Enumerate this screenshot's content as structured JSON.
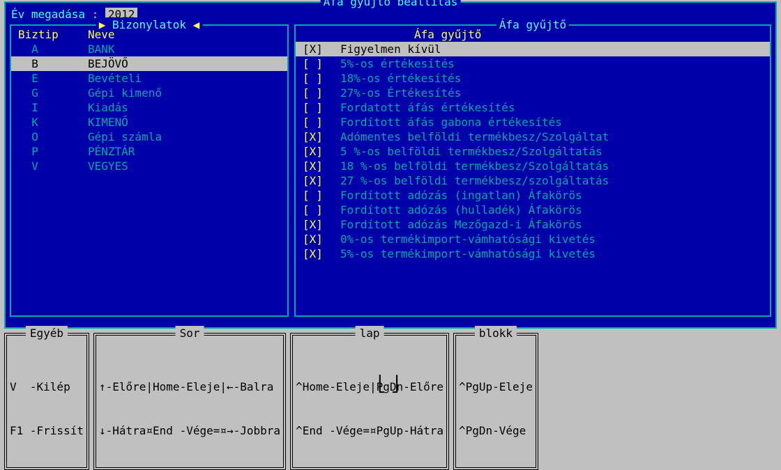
{
  "window_title": "Áfa gyűjtő beállítás",
  "year_label": "Év megadása : ",
  "year_value": "2012",
  "left_panel": {
    "title": "Bizonylatok",
    "col1": "Biztip",
    "col2": "Neve",
    "rows": [
      {
        "code": "A",
        "name": "BANK",
        "selected": false
      },
      {
        "code": "B",
        "name": "BEJÖVŐ",
        "selected": true
      },
      {
        "code": "E",
        "name": "Bevételi",
        "selected": false
      },
      {
        "code": "G",
        "name": "Gépi kimenő",
        "selected": false
      },
      {
        "code": "I",
        "name": "Kiadás",
        "selected": false
      },
      {
        "code": "K",
        "name": "KIMENŐ",
        "selected": false
      },
      {
        "code": "O",
        "name": "Gépi számla",
        "selected": false
      },
      {
        "code": "P",
        "name": "PÉNZTÁR",
        "selected": false
      },
      {
        "code": "V",
        "name": "VEGYES",
        "selected": false
      }
    ]
  },
  "right_panel": {
    "title": "Áfa gyűjtő",
    "header": "Áfa gyűjtő",
    "rows": [
      {
        "checked": true,
        "name": "Figyelmen kívül",
        "selected": true
      },
      {
        "checked": false,
        "name": "5%-os értékesítés",
        "selected": false
      },
      {
        "checked": false,
        "name": "18%-os értékesítés",
        "selected": false
      },
      {
        "checked": false,
        "name": "27%-os Értékesítés",
        "selected": false
      },
      {
        "checked": false,
        "name": "Fordatott áfás értékesítés",
        "selected": false
      },
      {
        "checked": false,
        "name": "Fordított áfás gabona értékesítés",
        "selected": false
      },
      {
        "checked": true,
        "name": "Adómentes belföldi termékbesz/Szolgáltat",
        "selected": false
      },
      {
        "checked": true,
        "name": "5 %-os  belföldi termékbesz/Szolgáltatás",
        "selected": false
      },
      {
        "checked": true,
        "name": "18 %-os belföldi termékbesz/Szolgáltatás",
        "selected": false
      },
      {
        "checked": true,
        "name": "27 %-os belföldi termékbesz/szolgáltatás",
        "selected": false
      },
      {
        "checked": false,
        "name": "Fordított adózás (ingatlan) Áfakörös",
        "selected": false
      },
      {
        "checked": false,
        "name": "Fordított adózás (hulladék) Áfakörös",
        "selected": false
      },
      {
        "checked": true,
        "name": "Fordított adózás Mezőgazd-i Áfakörös",
        "selected": false
      },
      {
        "checked": true,
        "name": " 0%-os termékimport-vámhatósági kivetés",
        "selected": false
      },
      {
        "checked": true,
        "name": " 5%-os termékimport-vámhatósági kivetés",
        "selected": false
      }
    ]
  },
  "help": {
    "egyeb": {
      "title": "Egyéb",
      "l1": "V  -Kilép",
      "l2": "F1 -Frissít"
    },
    "sor": {
      "title": "Sor",
      "l1": "↑-Előre|Home-Eleje|←-Balra",
      "l2": "↓-Hátra¤End -Vége=¤→-Jobbra"
    },
    "lap": {
      "title": "lap",
      "l1": "^Home-Eleje|PgDn-Előre",
      "l2": "^End -Vége=¤PgUp-Hátra"
    },
    "blokk": {
      "title": "blokk",
      "l1": "^PgUp-Eleje",
      "l2": "^PgDn-Vége"
    }
  },
  "bracket": "⎣⎦"
}
